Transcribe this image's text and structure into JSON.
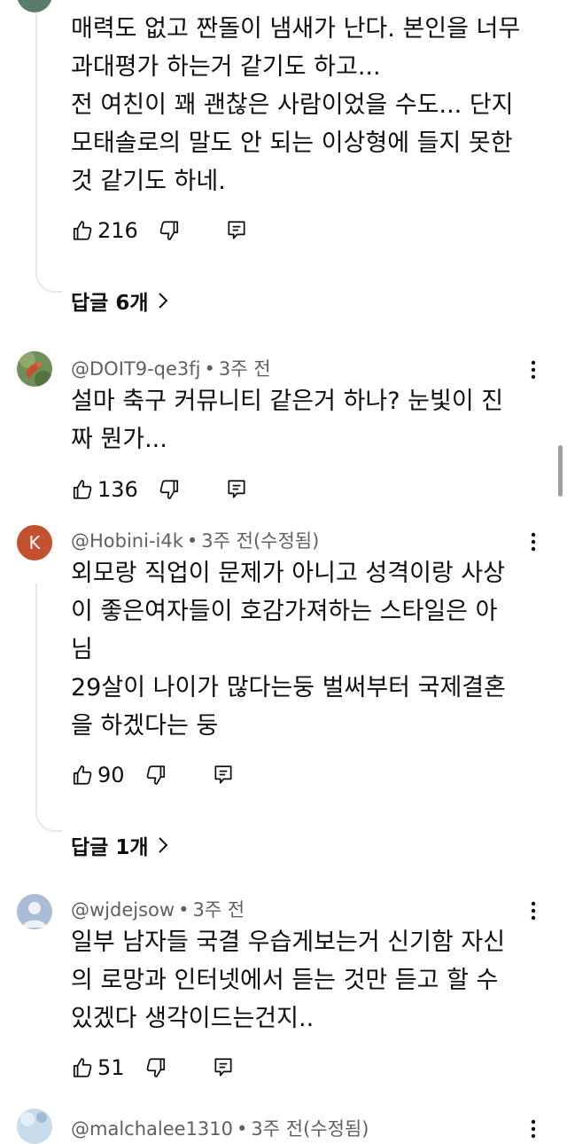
{
  "comments": [
    {
      "text_lines": [
        "매력도 없고 짠돌이 냄새가 난다. 본인을 너무",
        "과대평가 하는거 같기도 하고...",
        "전 여친이 꽤 괜찮은 사람이었을 수도... 단지",
        "모태솔로의 말도 안 되는 이상형에 들지 못한",
        "것 같기도 하네."
      ],
      "likes": "216",
      "replies_label": "답글 6개"
    },
    {
      "author": "@DOIT9-qe3fj",
      "time": "3주 전",
      "text_lines": [
        "설마 축구 커뮤니티 같은거 하나? 눈빛이 진",
        "짜 뭔가..."
      ],
      "likes": "136"
    },
    {
      "author": "@Hobini-i4k",
      "time": "3주 전(수정됨)",
      "avatar_letter": "K",
      "text_lines": [
        "외모랑 직업이 문제가 아니고 성격이랑 사상",
        "이 좋은여자들이 호감가져하는 스타일은 아",
        "님",
        "29살이 나이가 많다는둥 벌써부터 국제결혼",
        "을 하겠다는 둥"
      ],
      "likes": "90",
      "replies_label": "답글 1개"
    },
    {
      "author": "@wjdejsow",
      "time": "3주 전",
      "text_lines": [
        "일부 남자들 국결 우습게보는거 신기함 자신",
        "의 로망과 인터넷에서 듣는 것만 듣고 할 수",
        "있겠다 생각이드는건지.."
      ],
      "likes": "51"
    },
    {
      "author": "@malchalee1310",
      "time": "3주 전(수정됨)"
    }
  ],
  "icons": {
    "like": "thumbs-up-icon",
    "dislike": "thumbs-down-icon",
    "reply": "reply-comment-icon",
    "more": "kebab-menu-icon",
    "expand": "chevron-right-icon"
  },
  "colors": {
    "text": "#0f0f0f",
    "meta": "#606060",
    "k_avatar": "#c3512f",
    "default_avatar": "#a9bdd6"
  }
}
